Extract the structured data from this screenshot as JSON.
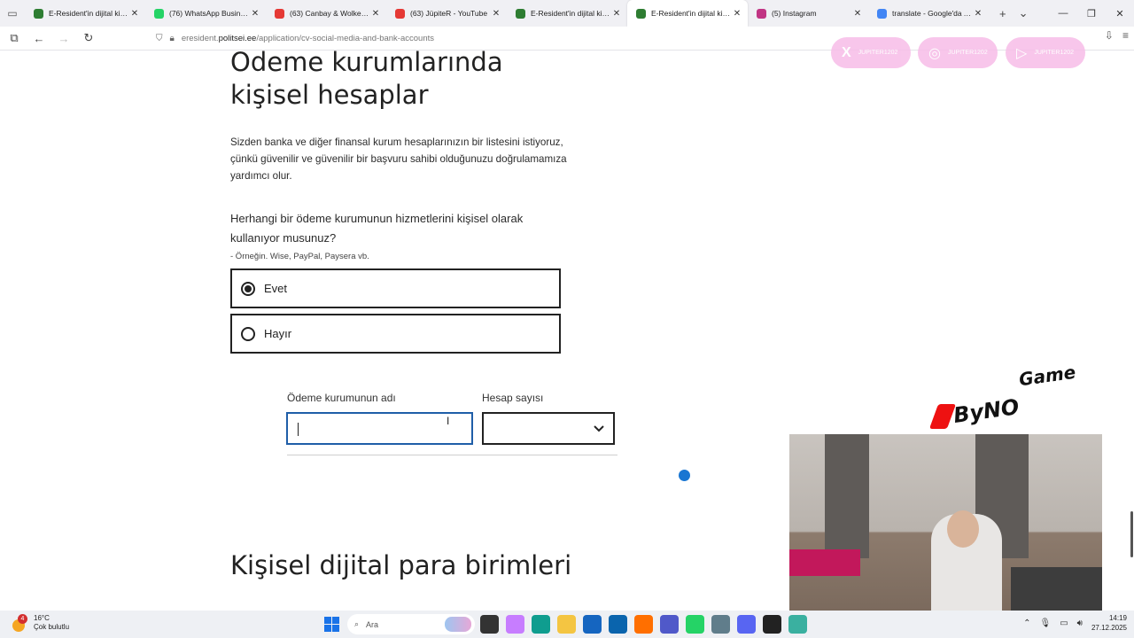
{
  "tabs": [
    {
      "title": "E-Resident'in dijital kimliği",
      "color": "#2e7d32",
      "active": false
    },
    {
      "title": "(76) WhatsApp Business",
      "color": "#25d366",
      "active": false
    },
    {
      "title": "(63) Canbay & Wolker - Ka",
      "color": "#e53935",
      "active": false
    },
    {
      "title": "(63) JüpiteR - YouTube",
      "color": "#e53935",
      "active": false
    },
    {
      "title": "E-Resident'in dijital kimliği",
      "color": "#2e7d32",
      "active": false
    },
    {
      "title": "E-Resident'in dijital kimliği",
      "color": "#2e7d32",
      "active": true
    },
    {
      "title": "(5) Instagram",
      "color": "#c13584",
      "active": false
    },
    {
      "title": "translate - Google'da Ara",
      "color": "#4285f4",
      "active": false
    }
  ],
  "address": {
    "prefix": "eresident.",
    "host": "politsei.ee",
    "path": "/application/cv-social-media-and-bank-accounts"
  },
  "social": [
    {
      "icon": "X",
      "handle": "JUPITER1202"
    },
    {
      "icon": "◎",
      "handle": "JUPITER1202"
    },
    {
      "icon": "▷",
      "handle": "JUPITER1202"
    }
  ],
  "section1": {
    "title_line1": "Ödeme kurumlarında",
    "title_line2": "kişisel hesaplar",
    "description_line1": "Sizden banka ve diğer finansal kurum hesaplarınızın bir listesini istiyoruz,",
    "description_line2": "çünkü güvenilir ve güvenilir bir başvuru sahibi olduğunuzu doğrulamamıza",
    "description_line3": "yardımcı olur.",
    "question_line1": "Herhangi bir ödeme kurumunun hizmetlerini kişisel olarak",
    "question_line2": "kullanıyor musunuz?",
    "hint": "- Örneğin. Wise, PayPal, Paysera vb.",
    "option_yes": "Evet",
    "option_no": "Hayır",
    "selected": "Evet",
    "field_name_label": "Ödeme kurumunun adı",
    "field_name_value": "",
    "field_count_label": "Hesap sayısı",
    "field_count_value": ""
  },
  "section2": {
    "title": "Kişisel dijital para birimleri"
  },
  "overlay": {
    "brand_part1": "ByN",
    "brand_o": "O",
    "brand_part2": "Game"
  },
  "taskbar": {
    "notification_count": "4",
    "temperature": "16°C",
    "weather": "Çok bulutlu",
    "search_placeholder": "Ara",
    "time": "14:19",
    "date": "27.12.2025"
  }
}
